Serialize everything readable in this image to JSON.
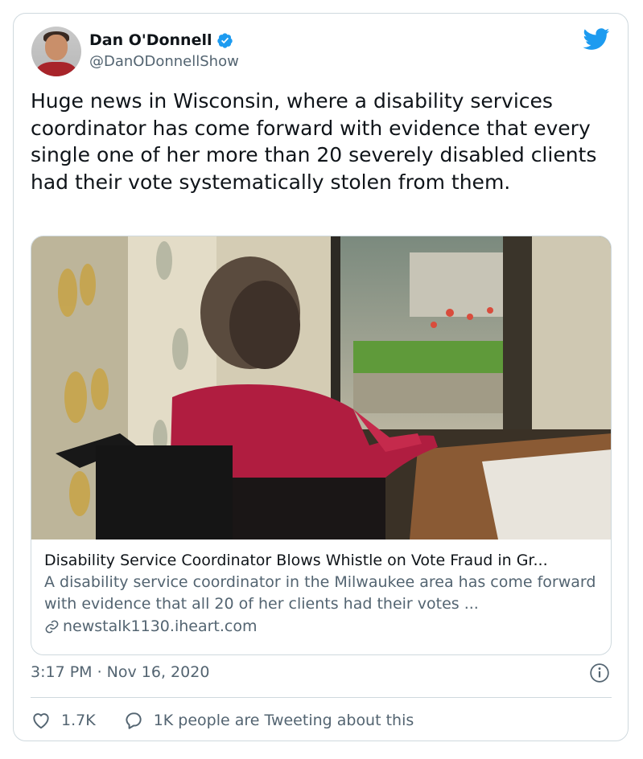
{
  "author": {
    "name": "Dan O'Donnell",
    "handle": "@DanODonnellShow"
  },
  "tweet": {
    "text": "Huge news in Wisconsin, where a disability services coordinator has come forward with evidence that every single one of her more than 20 severely disabled clients had their vote systematically stolen from them."
  },
  "link_card": {
    "title": "Disability Service Coordinator Blows Whistle on Vote Fraud in Gr...",
    "description": "A disability service coordinator in the Milwaukee area has come forward with evidence that all 20 of her clients had their votes ...",
    "domain": "newstalk1130.iheart.com"
  },
  "timestamp": "3:17 PM · Nov 16, 2020",
  "actions": {
    "likes": "1.7K",
    "conversation": "1K people are Tweeting about this"
  },
  "icons": {
    "verified": "verified-badge-icon",
    "brand": "twitter-bird-icon",
    "link": "link-icon",
    "info": "info-icon",
    "like": "heart-icon",
    "reply": "reply-bubble-icon"
  },
  "colors": {
    "brand": "#1d9bf0",
    "text": "#0f1419",
    "secondary": "#536471",
    "border": "#cfd9de"
  }
}
